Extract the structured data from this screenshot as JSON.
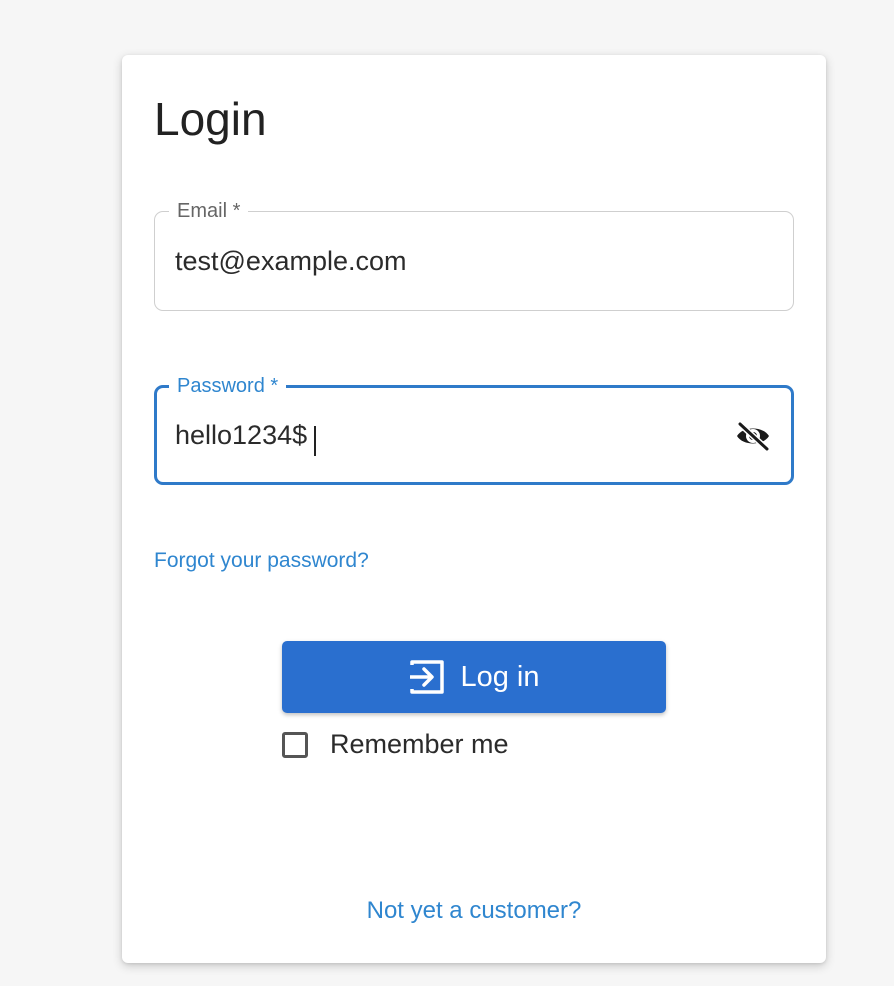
{
  "login": {
    "title": "Login",
    "email": {
      "label": "Email *",
      "value": "test@example.com"
    },
    "password": {
      "label": "Password *",
      "value": "hello1234$",
      "visibility_icon": "eye-off-icon"
    },
    "forgot_link": "Forgot your password?",
    "login_button": {
      "label": "Log in",
      "icon": "login-icon"
    },
    "remember_me": {
      "label": "Remember me",
      "checked": false
    },
    "signup_link": "Not yet a customer?"
  },
  "colors": {
    "accent": "#2f86cf",
    "button": "#2a6fcf",
    "text": "#222222",
    "background": "#f6f6f6"
  }
}
